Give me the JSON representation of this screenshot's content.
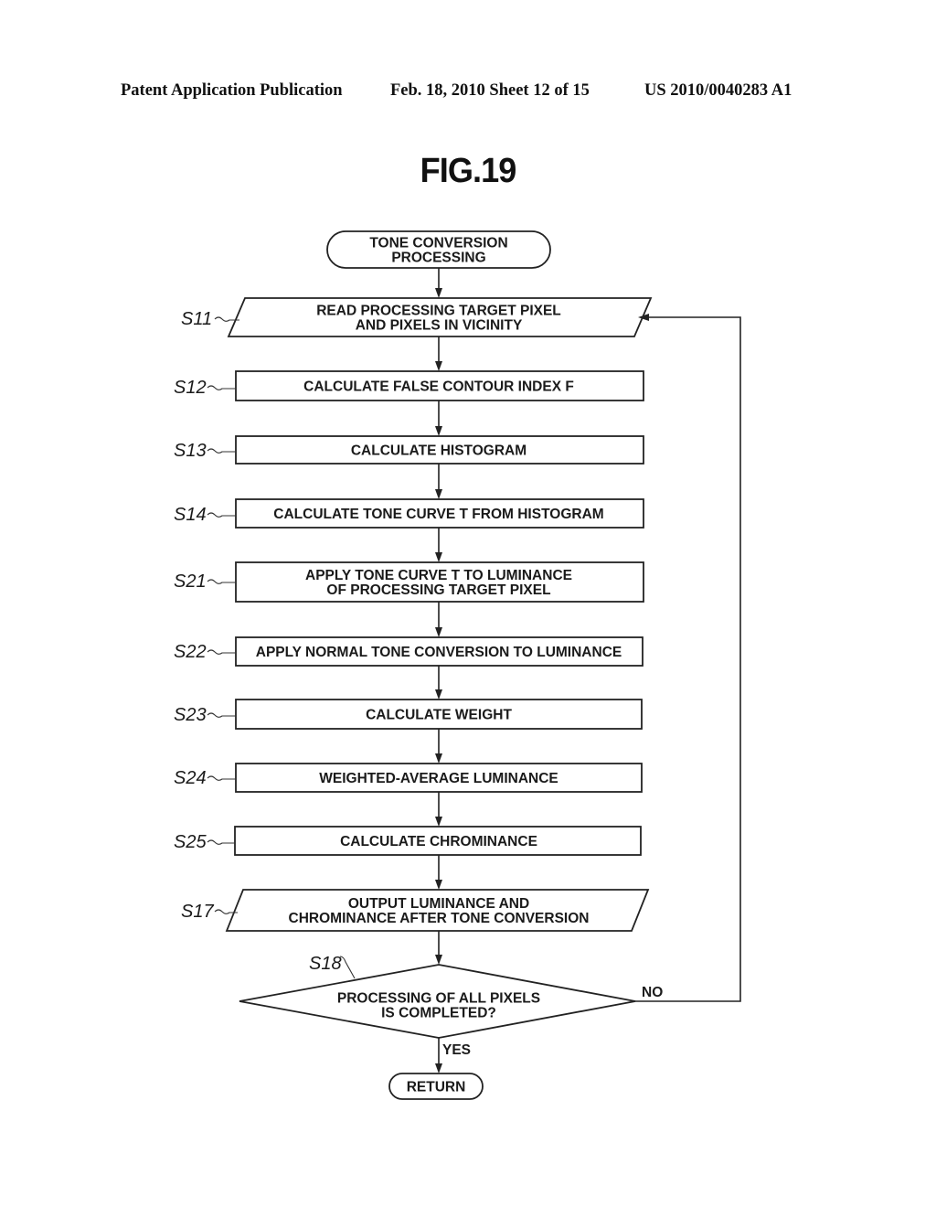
{
  "header": {
    "publication": "Patent Application Publication",
    "date_sheet": "Feb. 18, 2010   Sheet 12 of 15",
    "patent_number": "US 2010/0040283 A1"
  },
  "figure": {
    "title": "FIG.19"
  },
  "flowchart": {
    "start": {
      "lines": [
        "TONE CONVERSION",
        "PROCESSING"
      ]
    },
    "steps": [
      {
        "id": "S11",
        "type": "io",
        "lines": [
          "READ PROCESSING TARGET PIXEL",
          "AND PIXELS IN VICINITY"
        ]
      },
      {
        "id": "S12",
        "type": "process",
        "lines": [
          "CALCULATE FALSE CONTOUR INDEX F"
        ]
      },
      {
        "id": "S13",
        "type": "process",
        "lines": [
          "CALCULATE HISTOGRAM"
        ]
      },
      {
        "id": "S14",
        "type": "process",
        "lines": [
          "CALCULATE TONE CURVE T FROM HISTOGRAM"
        ]
      },
      {
        "id": "S21",
        "type": "process",
        "lines": [
          "APPLY TONE CURVE T TO LUMINANCE",
          "OF PROCESSING TARGET PIXEL"
        ]
      },
      {
        "id": "S22",
        "type": "process",
        "lines": [
          "APPLY NORMAL TONE CONVERSION TO LUMINANCE"
        ]
      },
      {
        "id": "S23",
        "type": "process",
        "lines": [
          "CALCULATE WEIGHT"
        ]
      },
      {
        "id": "S24",
        "type": "process",
        "lines": [
          "WEIGHTED-AVERAGE LUMINANCE"
        ]
      },
      {
        "id": "S25",
        "type": "process",
        "lines": [
          "CALCULATE CHROMINANCE"
        ]
      },
      {
        "id": "S17",
        "type": "io",
        "lines": [
          "OUTPUT LUMINANCE AND",
          "CHROMINANCE AFTER TONE CONVERSION"
        ]
      }
    ],
    "decision": {
      "id": "S18",
      "lines": [
        "PROCESSING OF ALL PIXELS",
        "IS COMPLETED?"
      ],
      "no_label": "NO",
      "yes_label": "YES"
    },
    "end": {
      "lines": [
        "RETURN"
      ]
    }
  }
}
